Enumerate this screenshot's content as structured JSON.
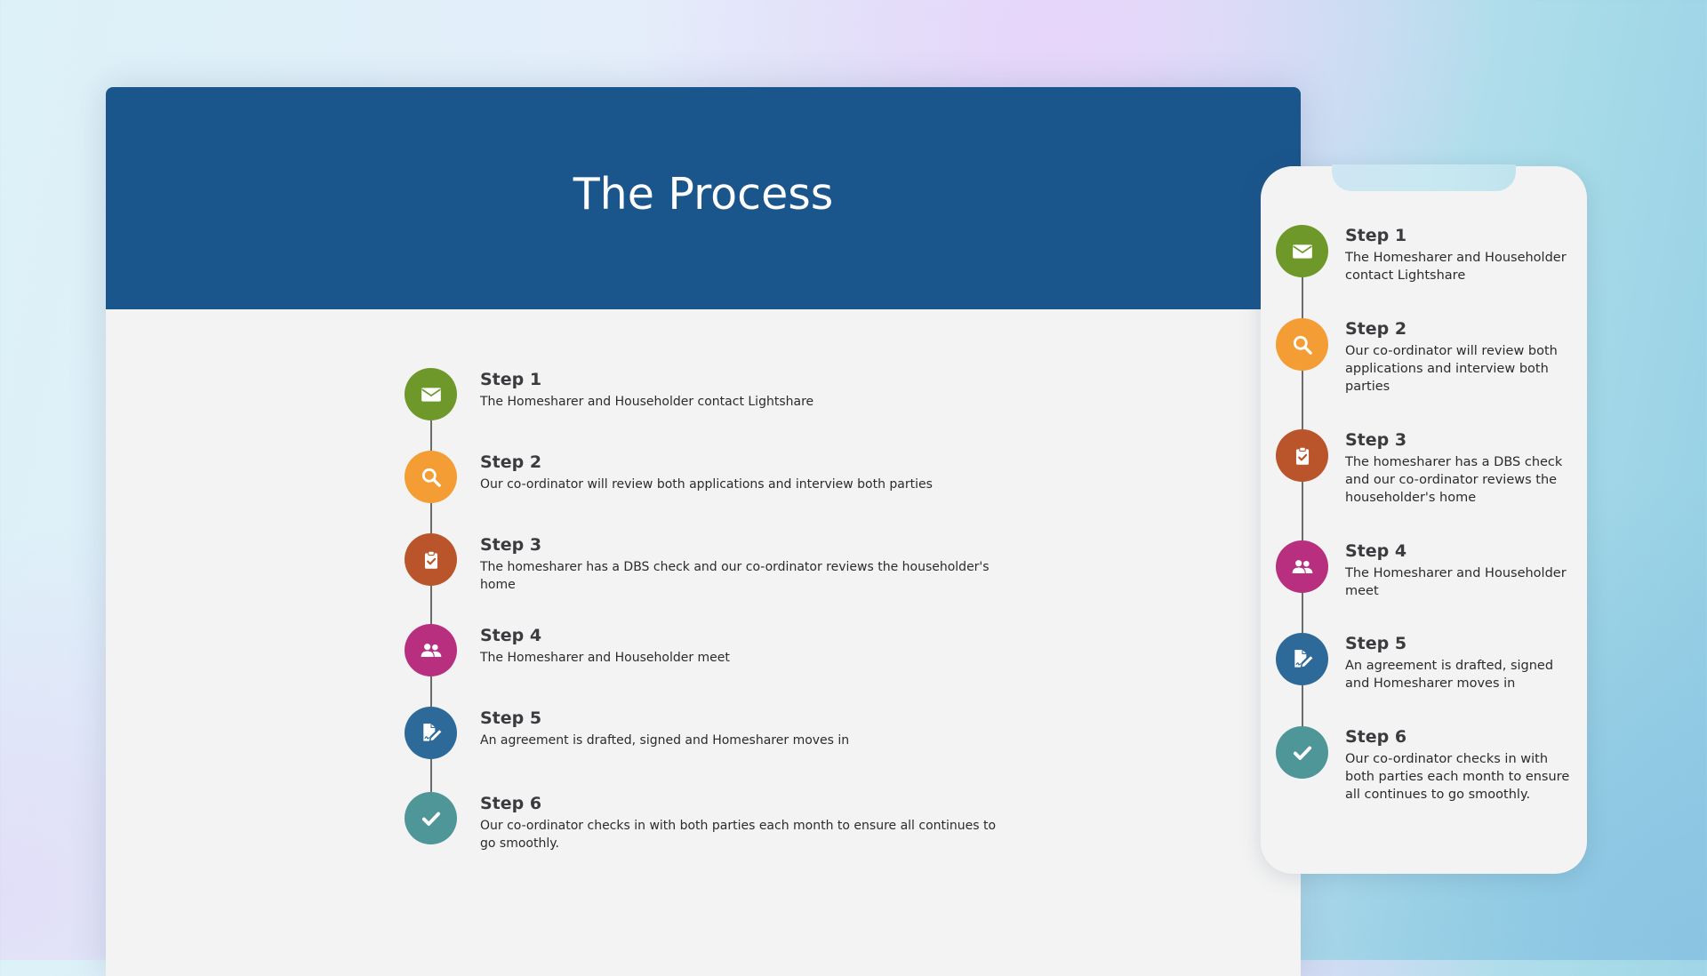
{
  "desktop": {
    "title": "The Process",
    "header_color": "#1a558b",
    "steps": [
      {
        "heading": "Step 1",
        "body": "The Homesharer and Householder contact Lightshare",
        "icon": "envelope-icon",
        "color": "#6f982a"
      },
      {
        "heading": "Step 2",
        "body": "Our co-ordinator will review both applications and interview both parties",
        "icon": "search-icon",
        "color": "#f39d34"
      },
      {
        "heading": "Step 3",
        "body": "The homesharer has a DBS check and our co-ordinator reviews the householder's home",
        "icon": "clipboard-check-icon",
        "color": "#ba552b"
      },
      {
        "heading": "Step 4",
        "body": "The Homesharer and Householder meet",
        "icon": "users-icon",
        "color": "#b82f7f"
      },
      {
        "heading": "Step 5",
        "body": "An agreement is drafted, signed and Homesharer moves in",
        "icon": "signed-document-icon",
        "color": "#2e6a99"
      },
      {
        "heading": "Step 6",
        "body": "Our co-ordinator checks in with both parties each month to ensure all continues to go smoothly.",
        "icon": "checkmark-icon",
        "color": "#4f9699"
      }
    ]
  },
  "mobile": {
    "steps": [
      {
        "heading": "Step 1",
        "body": "The Homesharer and Householder contact Lightshare",
        "icon": "envelope-icon",
        "color": "#6f982a"
      },
      {
        "heading": "Step 2",
        "body": "Our co-ordinator will review both applications and interview both parties",
        "icon": "search-icon",
        "color": "#f39d34"
      },
      {
        "heading": "Step 3",
        "body": "The homesharer has a DBS check and our co-ordinator reviews the householder's home",
        "icon": "clipboard-check-icon",
        "color": "#ba552b"
      },
      {
        "heading": "Step 4",
        "body": "The Homesharer and Householder meet",
        "icon": "users-icon",
        "color": "#b82f7f"
      },
      {
        "heading": "Step 5",
        "body": "An agreement is drafted, signed and Homesharer moves in",
        "icon": "signed-document-icon",
        "color": "#2e6a99"
      },
      {
        "heading": "Step 6",
        "body": "Our co-ordinator checks in with both parties each month to ensure all continues to go smoothly.",
        "icon": "checkmark-icon",
        "color": "#4f9699"
      }
    ]
  }
}
